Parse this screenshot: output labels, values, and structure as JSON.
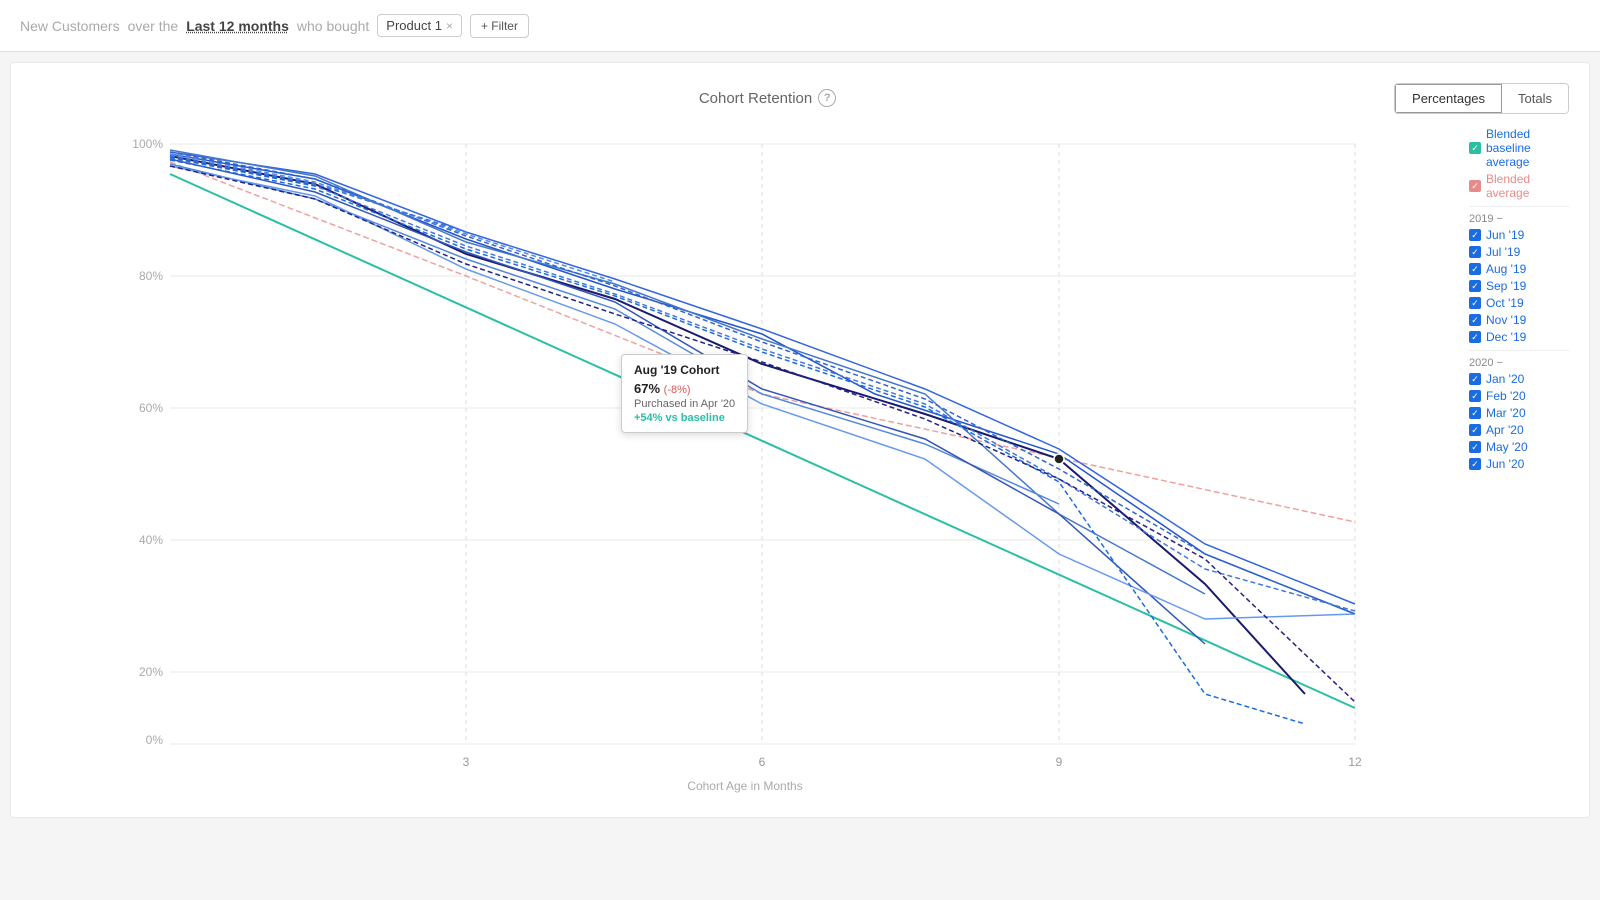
{
  "header": {
    "prefix": "New Customers",
    "over_the": "over the",
    "period": "Last 12 months",
    "who_bought": "who bought",
    "product": "Product 1",
    "filter_button": "+ Filter"
  },
  "chart": {
    "title": "Cohort Retention",
    "help_icon": "?",
    "toggle": {
      "percentages": "Percentages",
      "totals": "Totals",
      "active": "Percentages"
    },
    "x_axis": {
      "label": "Cohort Age in Months",
      "ticks": [
        3,
        6,
        9,
        12
      ]
    },
    "y_axis": {
      "ticks": [
        "100%",
        "80%",
        "60%",
        "40%",
        "20%",
        "0%"
      ]
    }
  },
  "legend": {
    "blended_baseline_label": "Blended baseline average",
    "blended_label": "Blended average",
    "year_2019_label": "2019 −",
    "items_2019": [
      "Jun '19",
      "Jul '19",
      "Aug '19",
      "Sep '19",
      "Oct '19",
      "Nov '19",
      "Dec '19"
    ],
    "year_2020_label": "2020 −",
    "items_2020": [
      "Jan '20",
      "Feb '20",
      "Mar '20",
      "Apr '20",
      "May '20",
      "Jun '20"
    ]
  },
  "tooltip": {
    "title": "Aug '19 Cohort",
    "percentage": "67%",
    "change": "(-8%)",
    "purchased_label": "Purchased in Apr '20",
    "vs_baseline": "+54% vs baseline"
  }
}
